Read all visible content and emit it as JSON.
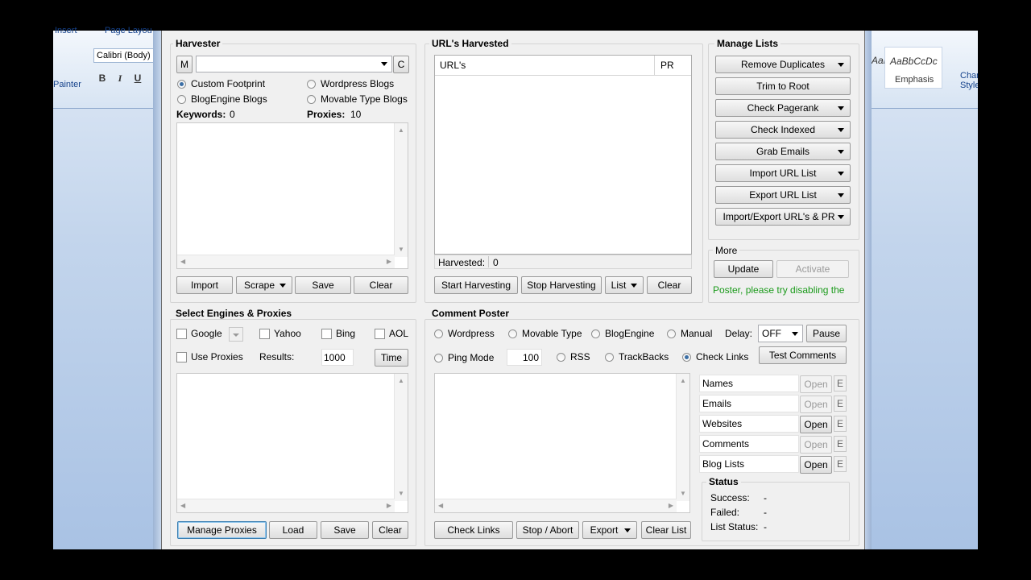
{
  "background_window": {
    "ribbon_tab_left": "Insert",
    "ribbon_tab_left2": "Page Layou",
    "font_name": "Calibri (Body)",
    "painter_label": "Painter",
    "bold": "B",
    "italic": "I",
    "underline": "U",
    "style_sample_1": "AaBbCcDc",
    "style_sample_2": "AaBbCcDc",
    "style_emphasis": "Emphasis",
    "change_styles": "Change Styles"
  },
  "harvester": {
    "title": "Harvester",
    "m_button": "M",
    "c_button": "C",
    "footprint_value": "",
    "radios": [
      {
        "label": "Custom Footprint",
        "checked": true
      },
      {
        "label": "Wordpress Blogs",
        "checked": false
      },
      {
        "label": "BlogEngine Blogs",
        "checked": false
      },
      {
        "label": "Movable Type Blogs",
        "checked": false
      }
    ],
    "keywords_label": "Keywords:",
    "keywords_count": "0",
    "proxies_label": "Proxies:",
    "proxies_count": "10",
    "buttons": {
      "import": "Import",
      "scrape": "Scrape",
      "save": "Save",
      "clear": "Clear"
    }
  },
  "urls_harvested": {
    "title": "URL's Harvested",
    "columns": [
      "URL's",
      "PR"
    ],
    "harvested_label": "Harvested:",
    "harvested_count": "0",
    "buttons": {
      "start": "Start Harvesting",
      "stop": "Stop Harvesting",
      "list": "List",
      "clear": "Clear"
    }
  },
  "manage_lists": {
    "title": "Manage Lists",
    "buttons": [
      {
        "label": "Remove Duplicates",
        "dropdown": true
      },
      {
        "label": "Trim to Root",
        "dropdown": false
      },
      {
        "label": "Check Pagerank",
        "dropdown": true
      },
      {
        "label": "Check Indexed",
        "dropdown": true
      },
      {
        "label": "Grab Emails",
        "dropdown": true
      },
      {
        "label": "Import URL List",
        "dropdown": true
      },
      {
        "label": "Export URL List",
        "dropdown": true
      },
      {
        "label": "Import/Export URL's & PR",
        "dropdown": true
      }
    ]
  },
  "more": {
    "title": "More",
    "update": "Update",
    "activate": "Activate",
    "message": "Poster, please try disabling the"
  },
  "engines": {
    "title": "Select Engines & Proxies",
    "google": "Google",
    "yahoo": "Yahoo",
    "bing": "Bing",
    "aol": "AOL",
    "use_proxies": "Use Proxies",
    "results_label": "Results:",
    "results_value": "1000",
    "time": "Time",
    "buttons": {
      "manage": "Manage Proxies",
      "load": "Load",
      "save": "Save",
      "clear": "Clear"
    }
  },
  "comment_poster": {
    "title": "Comment Poster",
    "radios_row1": [
      {
        "label": "Wordpress",
        "checked": false
      },
      {
        "label": "Movable Type",
        "checked": false
      },
      {
        "label": "BlogEngine",
        "checked": false
      },
      {
        "label": "Manual",
        "checked": false
      }
    ],
    "delay_label": "Delay:",
    "delay_value": "OFF",
    "pause": "Pause",
    "ping_mode": "Ping Mode",
    "ping_value": "100",
    "rss": "RSS",
    "trackbacks": "TrackBacks",
    "check_links_radio": "Check Links",
    "test_comments": "Test Comments",
    "lists": [
      {
        "label": "Names",
        "open": "Open",
        "open_enabled": false,
        "e": "E"
      },
      {
        "label": "Emails",
        "open": "Open",
        "open_enabled": false,
        "e": "E"
      },
      {
        "label": "Websites",
        "open": "Open",
        "open_enabled": true,
        "e": "E"
      },
      {
        "label": "Comments",
        "open": "Open",
        "open_enabled": false,
        "e": "E"
      },
      {
        "label": "Blog Lists",
        "open": "Open",
        "open_enabled": true,
        "e": "E"
      }
    ],
    "status": {
      "title": "Status",
      "success_label": "Success:",
      "success_value": "-",
      "failed_label": "Failed:",
      "failed_value": "-",
      "list_status_label": "List Status:",
      "list_status_value": "-"
    },
    "buttons": {
      "check_links": "Check Links",
      "stop": "Stop / Abort",
      "export": "Export",
      "clear_list": "Clear List"
    }
  },
  "icons": {
    "dropdown": "chevron-down-icon",
    "scroll_up": "arrow-up-icon",
    "scroll_down": "arrow-down-icon"
  }
}
